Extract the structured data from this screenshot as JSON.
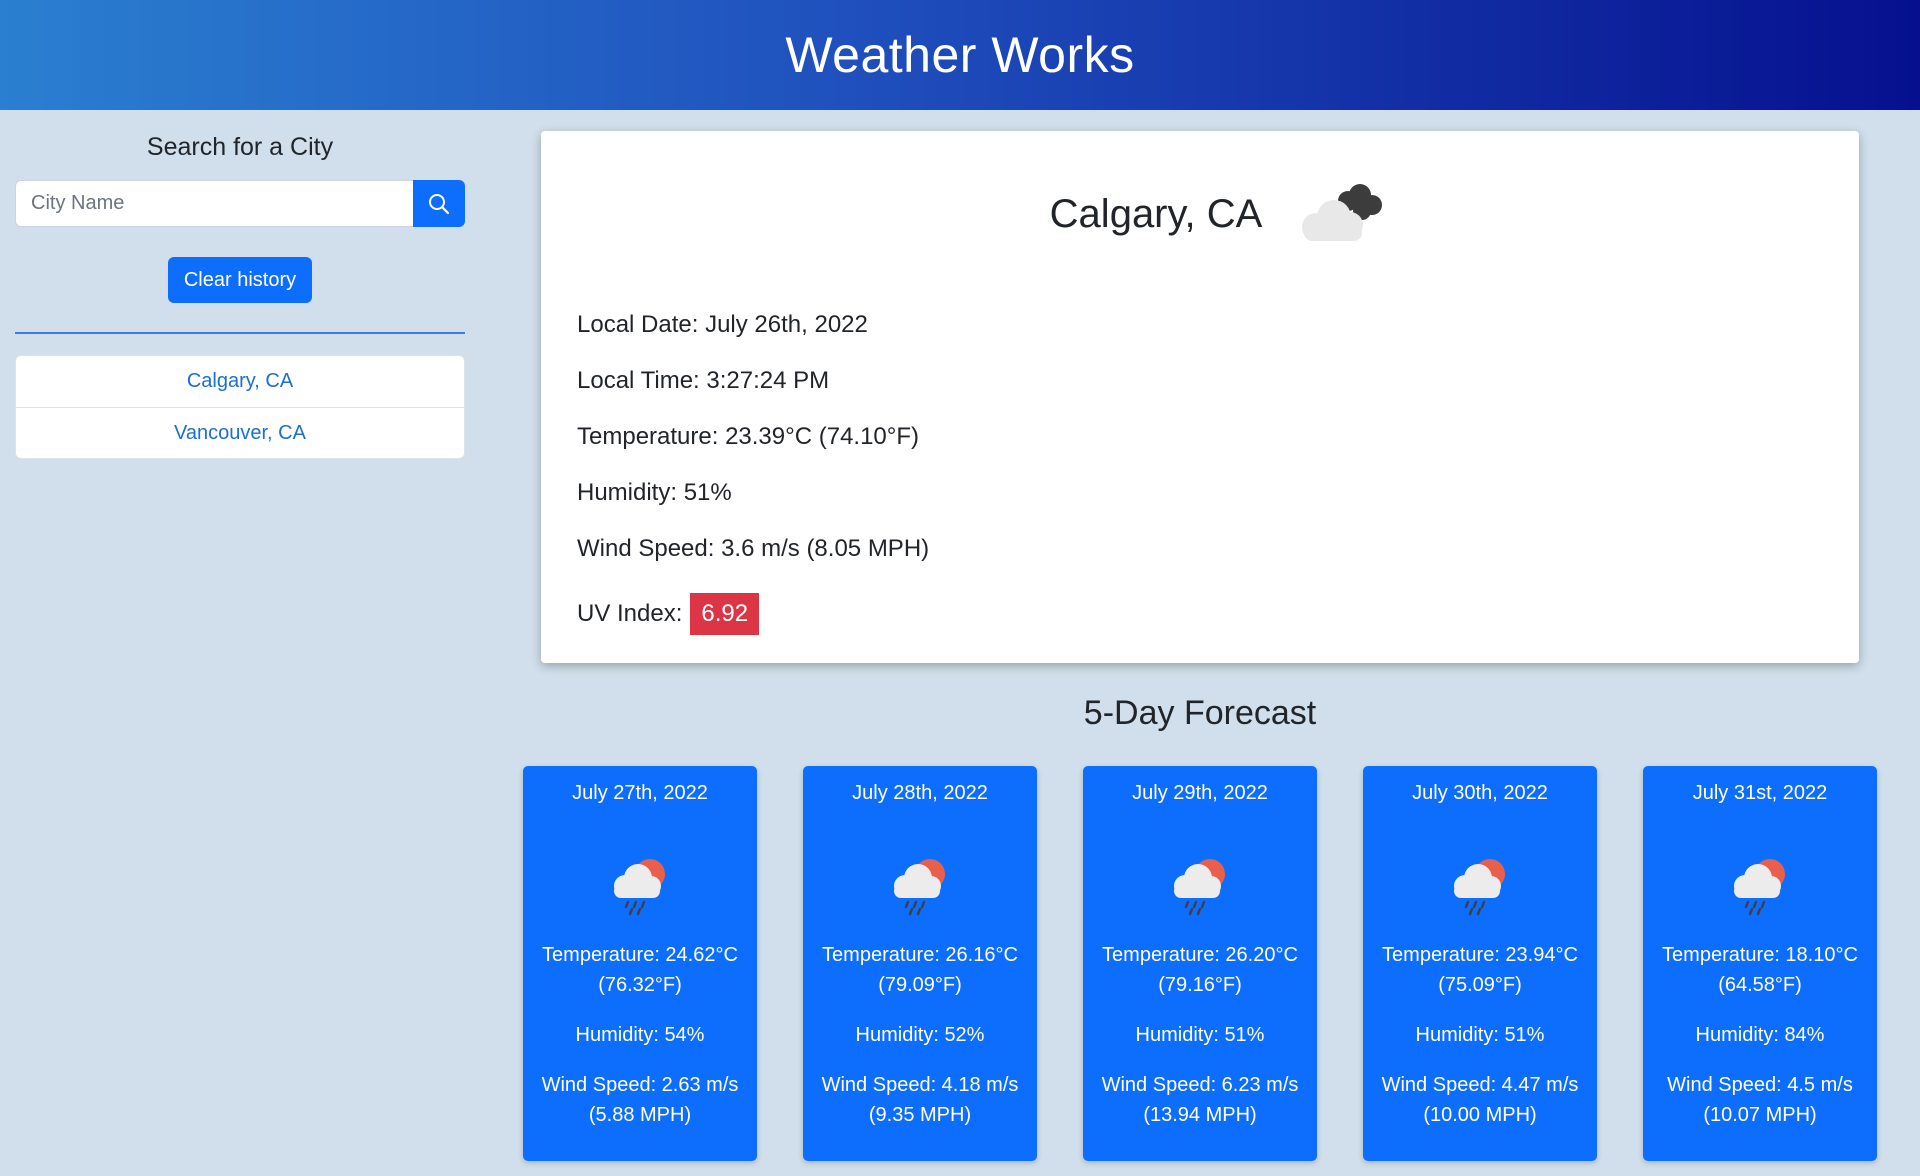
{
  "header": {
    "title": "Weather Works"
  },
  "sidebar": {
    "search_title": "Search for a City",
    "search_placeholder": "City Name",
    "search_value": "",
    "clear_label": "Clear history",
    "history": [
      "Calgary, CA",
      "Vancouver, CA"
    ]
  },
  "current": {
    "city": "Calgary, CA",
    "icon": "cloudy-icon",
    "date": "Local Date: July 26th, 2022",
    "time": "Local Time: 3:27:24 PM",
    "temperature": "Temperature: 23.39°C (74.10°F)",
    "humidity": "Humidity: 51%",
    "wind": "Wind Speed: 3.6 m/s (8.05 MPH)",
    "uv_label": "UV Index:",
    "uv_value": "6.92",
    "uv_color": "#dc3545"
  },
  "forecast": {
    "title": "5-Day Forecast",
    "days": [
      {
        "date": "July 27th, 2022",
        "icon": "rain-sun-icon",
        "temp_c": "Temperature: 24.62°C",
        "temp_f": "(76.32°F)",
        "humidity": "Humidity: 54%",
        "wind_ms": "Wind Speed: 2.63 m/s",
        "wind_mph": "(5.88 MPH)"
      },
      {
        "date": "July 28th, 2022",
        "icon": "rain-sun-icon",
        "temp_c": "Temperature: 26.16°C",
        "temp_f": "(79.09°F)",
        "humidity": "Humidity: 52%",
        "wind_ms": "Wind Speed: 4.18 m/s",
        "wind_mph": "(9.35 MPH)"
      },
      {
        "date": "July 29th, 2022",
        "icon": "rain-sun-icon",
        "temp_c": "Temperature: 26.20°C",
        "temp_f": "(79.16°F)",
        "humidity": "Humidity: 51%",
        "wind_ms": "Wind Speed: 6.23 m/s",
        "wind_mph": "(13.94 MPH)"
      },
      {
        "date": "July 30th, 2022",
        "icon": "rain-sun-icon",
        "temp_c": "Temperature: 23.94°C",
        "temp_f": "(75.09°F)",
        "humidity": "Humidity: 51%",
        "wind_ms": "Wind Speed: 4.47 m/s",
        "wind_mph": "(10.00 MPH)"
      },
      {
        "date": "July 31st, 2022",
        "icon": "rain-sun-icon",
        "temp_c": "Temperature: 18.10°C",
        "temp_f": "(64.58°F)",
        "humidity": "Humidity: 84%",
        "wind_ms": "Wind Speed: 4.5 m/s",
        "wind_mph": "(10.07 MPH)"
      }
    ]
  },
  "colors": {
    "accent": "#0d6efd",
    "page_bg": "#d0dfeb",
    "link": "#1a6ed8"
  }
}
